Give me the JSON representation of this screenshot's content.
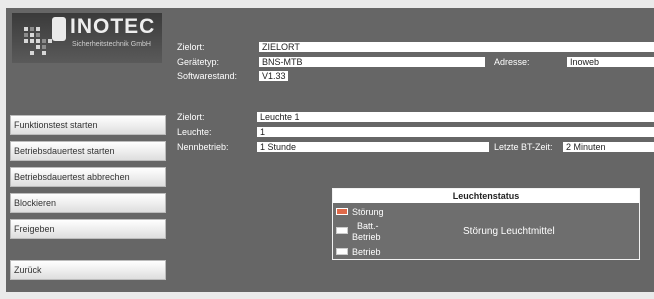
{
  "logo": {
    "brand": "INOTEC",
    "subtitle": "Sicherheitstechnik GmbH"
  },
  "device": {
    "zielort_label": "Zielort:",
    "zielort_value": "ZIELORT",
    "geraetetyp_label": "Gerätetyp:",
    "geraetetyp_value": "BNS-MTB",
    "adresse_label": "Adresse:",
    "adresse_value": "Inoweb",
    "software_label": "Softwarestand:",
    "software_value": "V1.33"
  },
  "lamp": {
    "zielort_label": "Zielort:",
    "zielort_value": "Leuchte 1",
    "leuchte_label": "Leuchte:",
    "leuchte_value": "1",
    "nennbetrieb_label": "Nennbetrieb:",
    "nennbetrieb_value": "1 Stunde",
    "bt_label": "Letzte BT-Zeit:",
    "bt_value": "2 Minuten"
  },
  "buttons": {
    "funktionstest": "Funktionstest starten",
    "dauertest_start": "Betriebsdauertest starten",
    "dauertest_stop": "Betriebsdauertest abbrechen",
    "blockieren": "Blockieren",
    "freigeben": "Freigeben",
    "zurueck": "Zurück"
  },
  "status": {
    "title": "Leuchtenstatus",
    "stoerung": "Störung",
    "batt_line1": "Batt.-",
    "batt_line2": "Betrieb",
    "betrieb": "Betrieb",
    "message": "Störung Leuchtmittel",
    "stoerung_color": "#e06a4a"
  }
}
